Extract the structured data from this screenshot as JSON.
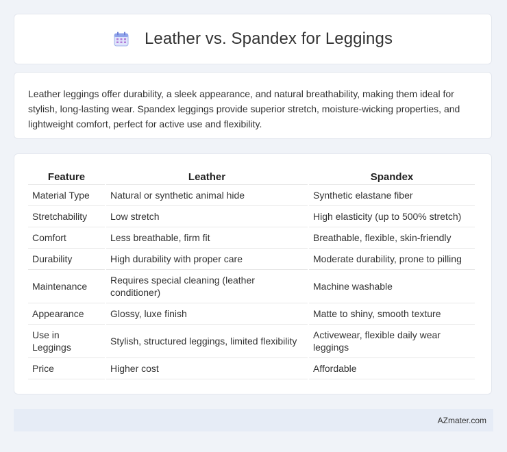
{
  "header": {
    "icon": "calendar-icon",
    "title": "Leather vs. Spandex for Leggings"
  },
  "summary": {
    "text": "Leather leggings offer durability, a sleek appearance, and natural breathability, making them ideal for stylish, long-lasting wear. Spandex leggings provide superior stretch, moisture-wicking properties, and lightweight comfort, perfect for active use and flexibility."
  },
  "table": {
    "headers": [
      "Feature",
      "Leather",
      "Spandex"
    ],
    "rows": [
      [
        "Material Type",
        "Natural or synthetic animal hide",
        "Synthetic elastane fiber"
      ],
      [
        "Stretchability",
        "Low stretch",
        "High elasticity (up to 500% stretch)"
      ],
      [
        "Comfort",
        "Less breathable, firm fit",
        "Breathable, flexible, skin-friendly"
      ],
      [
        "Durability",
        "High durability with proper care",
        "Moderate durability, prone to pilling"
      ],
      [
        "Maintenance",
        "Requires special cleaning (leather conditioner)",
        "Machine washable"
      ],
      [
        "Appearance",
        "Glossy, luxe finish",
        "Matte to shiny, smooth texture"
      ],
      [
        "Use in Leggings",
        "Stylish, structured leggings, limited flexibility",
        "Activewear, flexible daily wear leggings"
      ],
      [
        "Price",
        "Higher cost",
        "Affordable"
      ]
    ]
  },
  "footer": {
    "text": "AZmater.com"
  },
  "colors": {
    "background": "#f0f3f8",
    "card": "#ffffff",
    "footer": "#e6ecf6",
    "icon_accent": "#7b8cde"
  }
}
